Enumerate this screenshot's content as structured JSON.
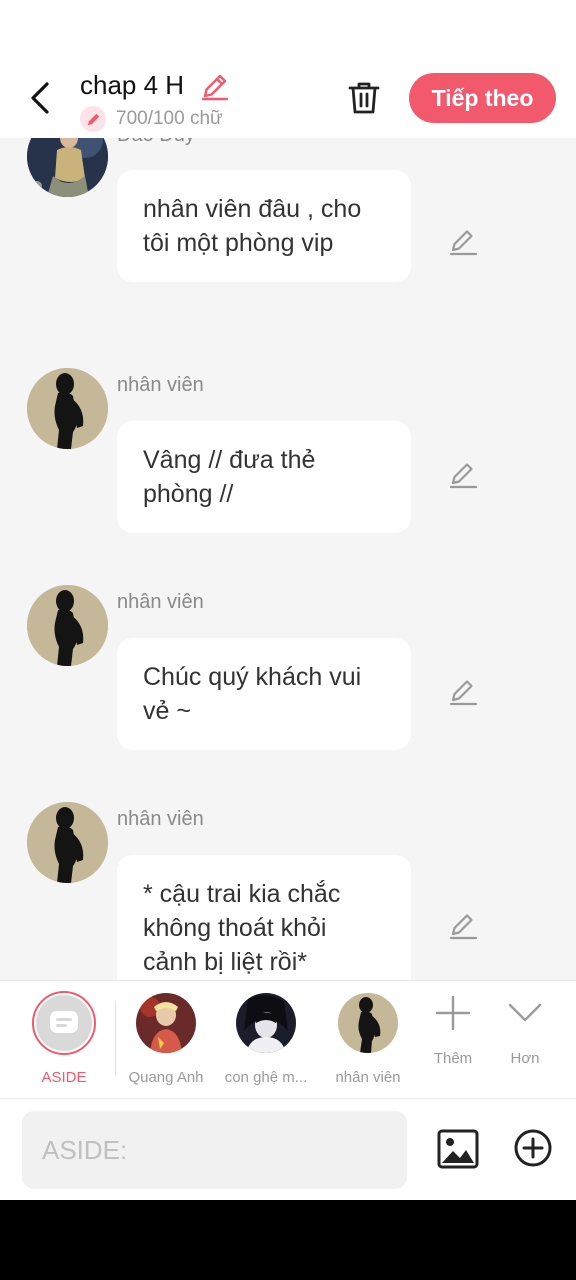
{
  "header": {
    "title": "chap 4 H",
    "word_count": "700/100 chữ",
    "next_label": "Tiếp theo",
    "accent": "#f2596d"
  },
  "messages": [
    {
      "sender": "Đào Duy",
      "text": "nhân viên đâu , cho tôi một phòng vip"
    },
    {
      "sender": "nhân viên",
      "text": "Vâng // đưa thẻ phòng //"
    },
    {
      "sender": "nhân viên",
      "text": "Chúc quý khách vui vẻ ~"
    },
    {
      "sender": "nhân viên",
      "text": "* cậu trai kia chắc không thoát khỏi cảnh bị liệt rồi*"
    }
  ],
  "characters": [
    {
      "label": "ASIDE",
      "icon": "aside-message-icon"
    },
    {
      "label": "Quang Anh"
    },
    {
      "label": "con ghệ m..."
    },
    {
      "label": "nhân viên"
    }
  ],
  "tools": {
    "add_label": "Thêm",
    "more_label": "Hơn"
  },
  "input": {
    "placeholder": "ASIDE:"
  }
}
